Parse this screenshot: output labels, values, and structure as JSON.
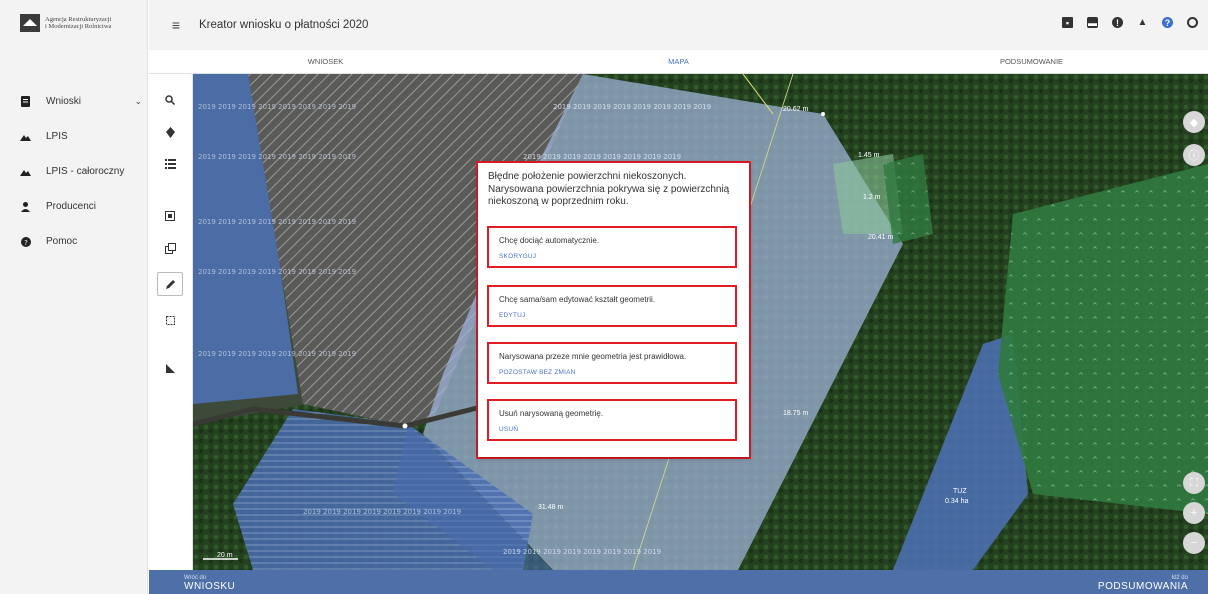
{
  "brand": {
    "name_line1": "Agencja Restrukturyzacji",
    "name_line2": "i Modernizacji Rolnictwa"
  },
  "sidebar": {
    "items": [
      {
        "label": "Wnioski",
        "icon": "document-icon",
        "expandable": true
      },
      {
        "label": "LPIS",
        "icon": "mountain-icon"
      },
      {
        "label": "LPIS - całoroczny",
        "icon": "mountain-icon"
      },
      {
        "label": "Producenci",
        "icon": "person-icon"
      },
      {
        "label": "Pomoc",
        "icon": "help-icon"
      }
    ]
  },
  "header": {
    "title": "Kreator wniosku o płatności 2020",
    "icons": [
      "save-icon",
      "print-icon",
      "info-icon",
      "bell-icon",
      "help-icon",
      "user-icon"
    ]
  },
  "tabs": [
    {
      "label": "WNIOSEK",
      "active": false
    },
    {
      "label": "MAPA",
      "active": true
    },
    {
      "label": "PODSUMOWANIE",
      "active": false
    }
  ],
  "map": {
    "labels": {
      "a": "20.62 m",
      "b": "1.45 m",
      "c": "1.2 m",
      "d": "20.41 m",
      "e": "18.75 m",
      "f": "TUZ",
      "g": "0.34 ha",
      "h": "31.48 m",
      "scale": "20 m"
    },
    "watermark_text": "2019 2019 2019 2019 2019 2019 2019 2019"
  },
  "dialog": {
    "message": "Błędne położenie powierzchni niekoszonych. Narysowana powierzchnia pokrywa się z powierzchnią niekoszoną w poprzednim roku.",
    "options": [
      {
        "text": "Chcę dociąć automatycznie.",
        "button": "SKORYGUJ"
      },
      {
        "text": "Chcę sama/sam edytować kształt geometrii.",
        "button": "EDYTUJ"
      },
      {
        "text": "Narysowana przeze mnie geometria jest prawidłowa.",
        "button": "POZOSTAW BEZ ZMIAN"
      },
      {
        "text": "Usuń narysowaną geometrię.",
        "button": "USUŃ"
      }
    ]
  },
  "footer": {
    "back_hint": "Wróć do",
    "back_label": "WNIOSKU",
    "next_hint": "Idź do",
    "next_label": "PODSUMOWANIA"
  },
  "colors": {
    "accent": "#4a72c6",
    "highlight": "#e21b24",
    "bottombar": "#4f6fa8"
  }
}
